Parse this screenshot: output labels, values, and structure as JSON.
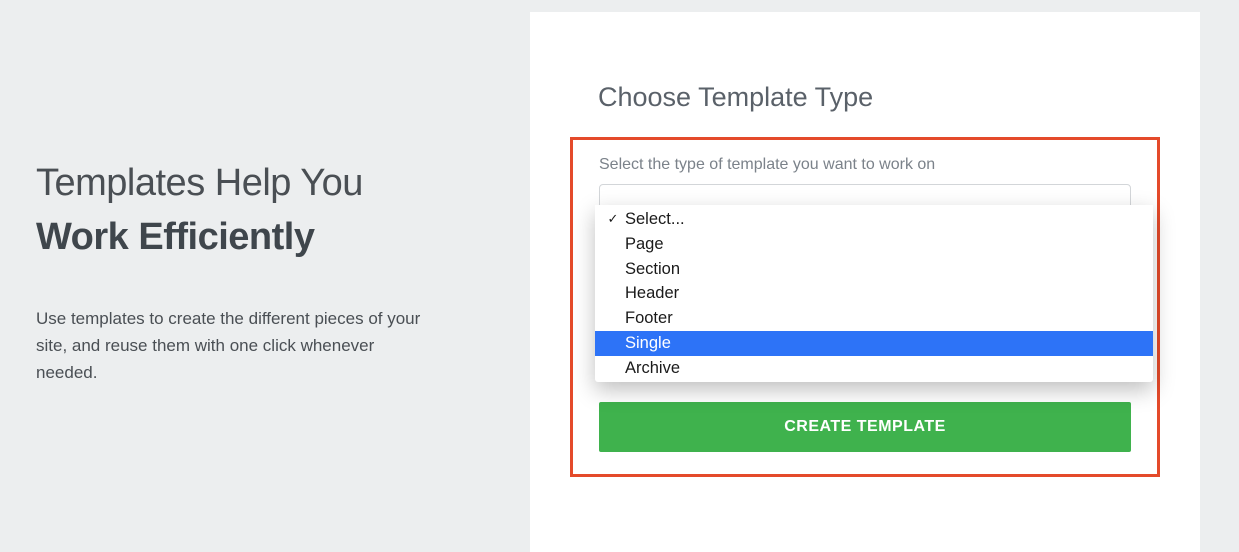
{
  "left": {
    "heading_line1": "Templates Help You",
    "heading_line2": "Work Efficiently",
    "description": "Use templates to create the different pieces of your site, and reuse them with one click whenever needed."
  },
  "card": {
    "title": "Choose Template Type",
    "select_label": "Select the type of template you want to work on",
    "name_label_hidden": "template",
    "create_button": "CREATE TEMPLATE",
    "dropdown": {
      "options": [
        {
          "label": "Select...",
          "checked": true
        },
        {
          "label": "Page",
          "checked": false
        },
        {
          "label": "Section",
          "checked": false
        },
        {
          "label": "Header",
          "checked": false
        },
        {
          "label": "Footer",
          "checked": false
        },
        {
          "label": "Single",
          "checked": false,
          "highlighted": true
        },
        {
          "label": "Archive",
          "checked": false
        }
      ]
    }
  }
}
